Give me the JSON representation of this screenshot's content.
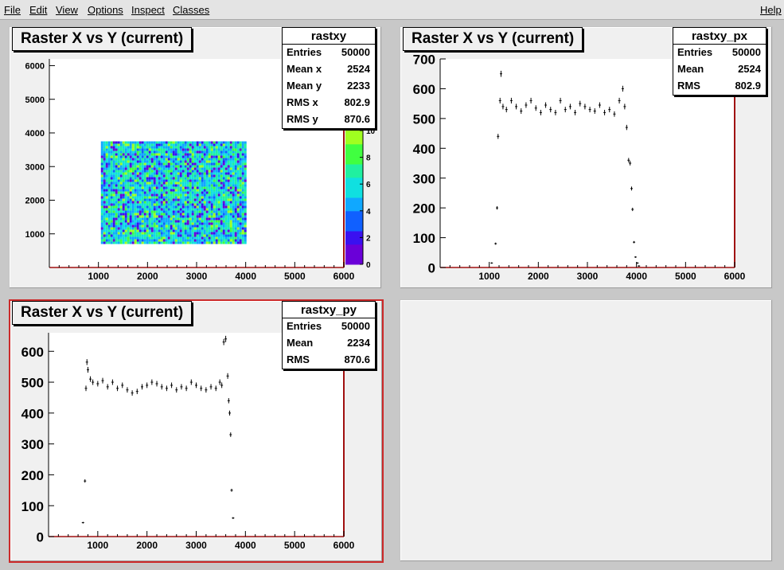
{
  "menubar": {
    "items": [
      {
        "label": "File"
      },
      {
        "label": "Edit"
      },
      {
        "label": "View"
      },
      {
        "label": "Options"
      },
      {
        "label": "Inspect"
      },
      {
        "label": "Classes"
      }
    ],
    "help": "Help"
  },
  "pads": {
    "top_left": {
      "title": "Raster X vs Y (current)",
      "stats": {
        "name": "rastxy",
        "rows": [
          {
            "label": "Entries",
            "value": "50000"
          },
          {
            "label": "Mean x",
            "value": "2524"
          },
          {
            "label": "Mean y",
            "value": "2233"
          },
          {
            "label": "RMS x",
            "value": "802.9"
          },
          {
            "label": "RMS y",
            "value": "870.6"
          }
        ]
      }
    },
    "top_right": {
      "title": "Raster X vs Y (current)",
      "stats": {
        "name": "rastxy_px",
        "rows": [
          {
            "label": "Entries",
            "value": "50000"
          },
          {
            "label": "Mean",
            "value": "2524"
          },
          {
            "label": "RMS",
            "value": "802.9"
          }
        ]
      }
    },
    "bottom_left": {
      "title": "Raster X vs Y (current)",
      "stats": {
        "name": "rastxy_py",
        "rows": [
          {
            "label": "Entries",
            "value": "50000"
          },
          {
            "label": "Mean",
            "value": "2234"
          },
          {
            "label": "RMS",
            "value": "870.6"
          }
        ]
      }
    }
  },
  "colors": {
    "accent_active_pad": "#cc2a2a",
    "frame_red": "#a01010"
  },
  "chart_data": [
    {
      "id": "rastxy",
      "type": "heatmap",
      "title": "Raster X vs Y (current)",
      "xlim": [
        0,
        6000
      ],
      "ylim": [
        0,
        6200
      ],
      "xticks": [
        1000,
        2000,
        3000,
        4000,
        5000,
        6000
      ],
      "yticks": [
        1000,
        2000,
        3000,
        4000,
        5000,
        6000
      ],
      "filled_region": {
        "x": [
          1050,
          4000
        ],
        "y": [
          700,
          3750
        ]
      },
      "z_scale": {
        "min": 0,
        "max": 10,
        "ticks": [
          0,
          2,
          4,
          6,
          8,
          10
        ]
      },
      "palette": [
        "#6a00d8",
        "#3a10f0",
        "#1060ff",
        "#10a8ff",
        "#10e0e0",
        "#20f0a0",
        "#40ff40",
        "#a0ff20"
      ]
    },
    {
      "id": "rastxy_px",
      "type": "scatter",
      "title": "Raster X vs Y (current)",
      "xlim": [
        0,
        6000
      ],
      "ylim": [
        0,
        700
      ],
      "xticks": [
        1000,
        2000,
        3000,
        4000,
        5000,
        6000
      ],
      "yticks": [
        0,
        100,
        200,
        300,
        400,
        500,
        600,
        700
      ],
      "x": [
        1050,
        1130,
        1160,
        1180,
        1220,
        1240,
        1280,
        1350,
        1450,
        1550,
        1650,
        1750,
        1850,
        1950,
        2050,
        2150,
        2250,
        2350,
        2450,
        2550,
        2650,
        2750,
        2850,
        2950,
        3050,
        3150,
        3250,
        3350,
        3450,
        3550,
        3650,
        3720,
        3760,
        3800,
        3840,
        3870,
        3900,
        3920,
        3950,
        3980,
        4020,
        4050
      ],
      "values": [
        15,
        80,
        200,
        440,
        560,
        650,
        540,
        530,
        560,
        540,
        525,
        545,
        560,
        535,
        520,
        545,
        530,
        520,
        560,
        530,
        540,
        520,
        550,
        540,
        530,
        525,
        545,
        520,
        530,
        515,
        560,
        600,
        540,
        470,
        360,
        350,
        265,
        195,
        85,
        35,
        15,
        5
      ]
    },
    {
      "id": "rastxy_py",
      "type": "scatter",
      "title": "Raster X vs Y (current)",
      "xlim": [
        0,
        6000
      ],
      "ylim": [
        0,
        660
      ],
      "xticks": [
        1000,
        2000,
        3000,
        4000,
        5000,
        6000
      ],
      "yticks": [
        0,
        100,
        200,
        300,
        400,
        500,
        600
      ],
      "x": [
        700,
        740,
        760,
        780,
        800,
        850,
        900,
        1000,
        1100,
        1200,
        1300,
        1400,
        1500,
        1600,
        1700,
        1800,
        1900,
        2000,
        2100,
        2200,
        2300,
        2400,
        2500,
        2600,
        2700,
        2800,
        2900,
        3000,
        3100,
        3200,
        3300,
        3400,
        3480,
        3520,
        3560,
        3600,
        3640,
        3660,
        3680,
        3700,
        3720,
        3750
      ],
      "values": [
        45,
        180,
        480,
        565,
        540,
        510,
        500,
        495,
        505,
        485,
        500,
        480,
        490,
        475,
        465,
        470,
        485,
        490,
        500,
        495,
        485,
        480,
        490,
        475,
        485,
        480,
        500,
        490,
        480,
        475,
        485,
        480,
        500,
        490,
        630,
        640,
        520,
        440,
        400,
        330,
        150,
        60
      ]
    }
  ]
}
